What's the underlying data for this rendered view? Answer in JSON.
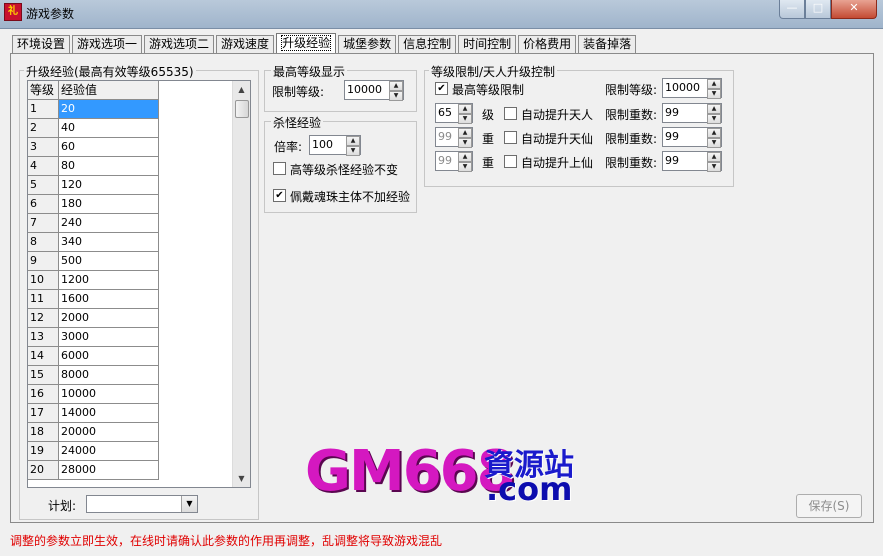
{
  "window": {
    "title": "游戏参数",
    "app_icon_text": "礼",
    "btn_minimize": "—",
    "btn_maximize": "□",
    "btn_close": "✕"
  },
  "tabs": [
    {
      "label": "环境设置"
    },
    {
      "label": "游戏选项一"
    },
    {
      "label": "游戏选项二"
    },
    {
      "label": "游戏速度"
    },
    {
      "label": "升级经验"
    },
    {
      "label": "城堡参数"
    },
    {
      "label": "信息控制"
    },
    {
      "label": "时间控制"
    },
    {
      "label": "价格费用"
    },
    {
      "label": "装备掉落"
    }
  ],
  "exp_group": {
    "title": "升级经验(最高有效等级65535)",
    "col_level": "等级",
    "col_exp": "经验值",
    "rows": [
      {
        "level": "1",
        "exp": "20"
      },
      {
        "level": "2",
        "exp": "40"
      },
      {
        "level": "3",
        "exp": "60"
      },
      {
        "level": "4",
        "exp": "80"
      },
      {
        "level": "5",
        "exp": "120"
      },
      {
        "level": "6",
        "exp": "180"
      },
      {
        "level": "7",
        "exp": "240"
      },
      {
        "level": "8",
        "exp": "340"
      },
      {
        "level": "9",
        "exp": "500"
      },
      {
        "level": "10",
        "exp": "1200"
      },
      {
        "level": "11",
        "exp": "1600"
      },
      {
        "level": "12",
        "exp": "2000"
      },
      {
        "level": "13",
        "exp": "3000"
      },
      {
        "level": "14",
        "exp": "6000"
      },
      {
        "level": "15",
        "exp": "8000"
      },
      {
        "level": "16",
        "exp": "10000"
      },
      {
        "level": "17",
        "exp": "14000"
      },
      {
        "level": "18",
        "exp": "20000"
      },
      {
        "level": "19",
        "exp": "24000"
      },
      {
        "level": "20",
        "exp": "28000"
      }
    ],
    "plan_label": "计划:",
    "plan_value": ""
  },
  "max_level_display": {
    "title": "最高等级显示",
    "limit_label": "限制等级:",
    "limit_value": "10000"
  },
  "kill_exp": {
    "title": "杀怪经验",
    "rate_label": "倍率:",
    "rate_value": "100",
    "high_level_unchanged": "高等级杀怪经验不变",
    "soul_bead_no_exp": "佩戴魂珠主体不加经验"
  },
  "level_limit": {
    "title": "等级限制/天人升级控制",
    "max_level_limit": "最高等级限制",
    "limit_level_label": "限制等级:",
    "limit_level_value": "10000",
    "rows": [
      {
        "num": "65",
        "unit": "级",
        "auto_label": "自动提升天人",
        "limit_label": "限制重数:",
        "limit_value": "99"
      },
      {
        "num": "99",
        "unit": "重",
        "auto_label": "自动提升天仙",
        "limit_label": "限制重数:",
        "limit_value": "99"
      },
      {
        "num": "99",
        "unit": "重",
        "auto_label": "自动提升上仙",
        "limit_label": "限制重数:",
        "limit_value": "99"
      }
    ]
  },
  "save_button": "保存(S)",
  "watermark": {
    "main": "GM668",
    "zh": "資源站",
    "com": ".com"
  },
  "status_message": "调整的参数立即生效，在线时请确认此参数的作用再调整，乱调整将导致游戏混乱",
  "colors": {
    "selection": "#3399ff",
    "warning_text": "#e00000",
    "watermark_pink": "#d418c0",
    "watermark_blue": "#1a1acc"
  }
}
